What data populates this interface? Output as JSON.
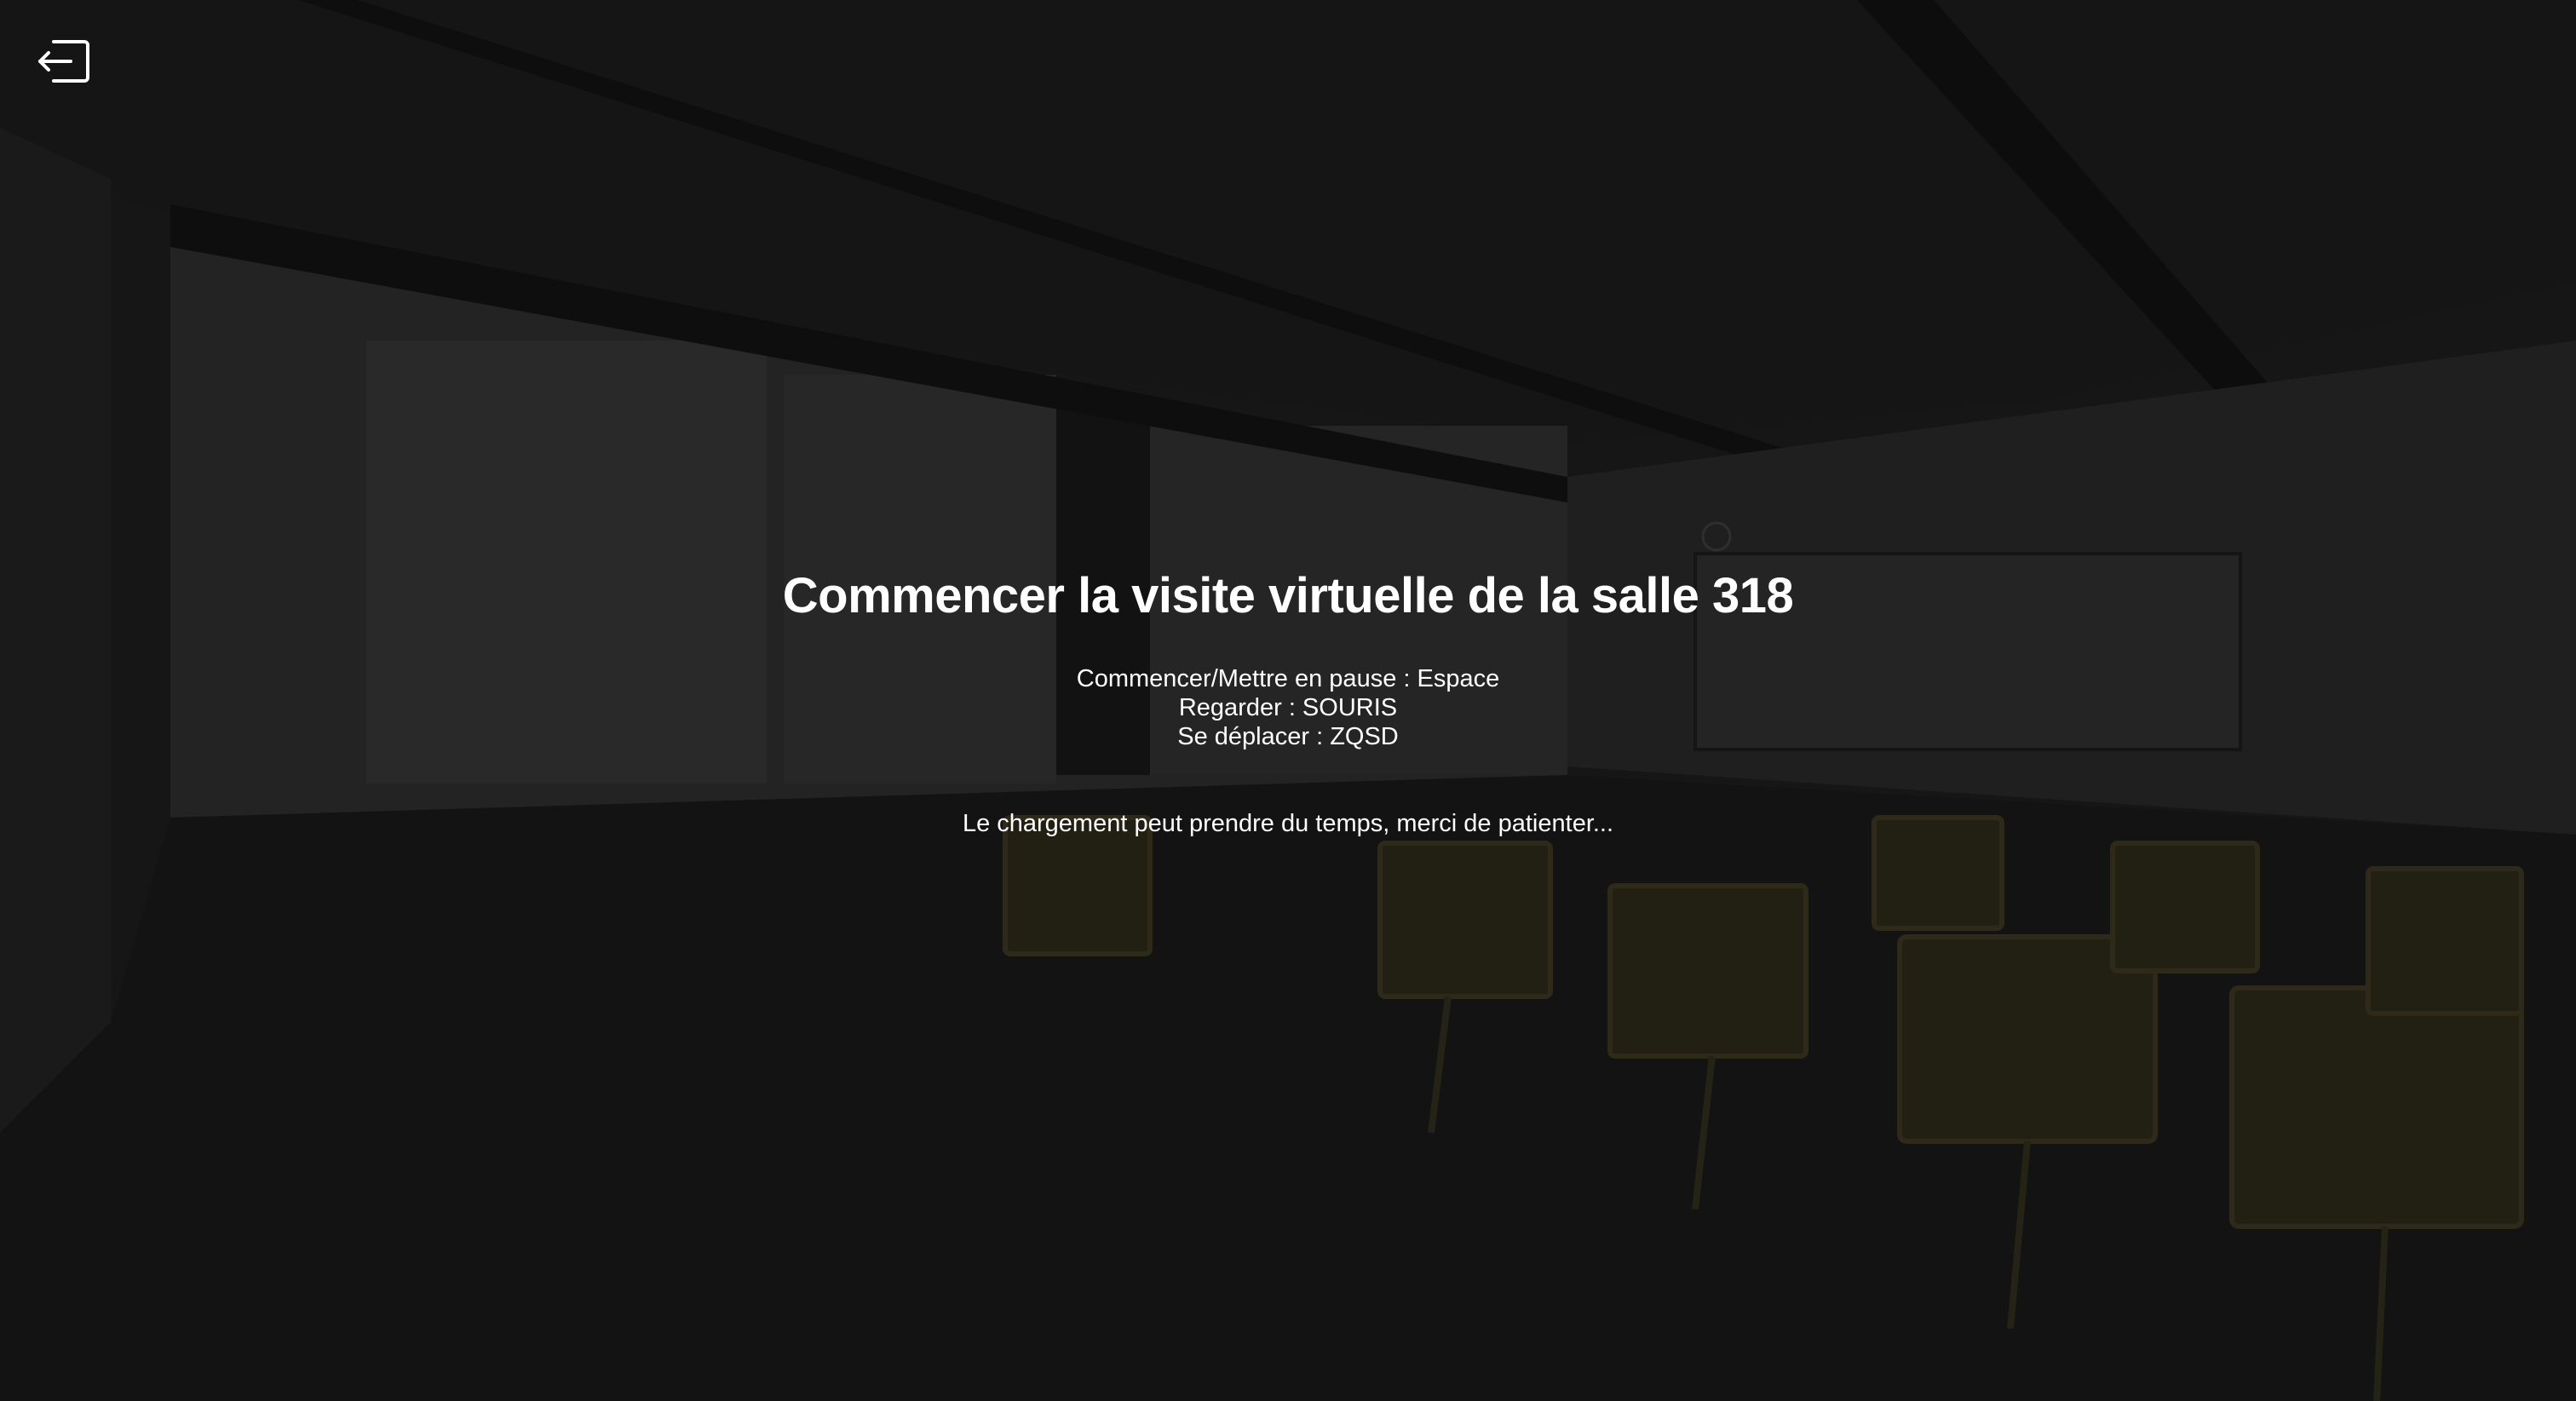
{
  "exit": {
    "icon": "exit-icon"
  },
  "start_screen": {
    "title": "Commencer la visite virtuelle de la salle 318",
    "controls": [
      "Commencer/Mettre en pause : Espace",
      "Regarder : SOURIS",
      "Se déplacer : ZQSD"
    ],
    "loading_message": "Le chargement peut prendre du temps, merci de patienter..."
  },
  "colors": {
    "text": "#ffffff",
    "background": "#1c1c1c",
    "chair_tint": "#3a3220"
  }
}
